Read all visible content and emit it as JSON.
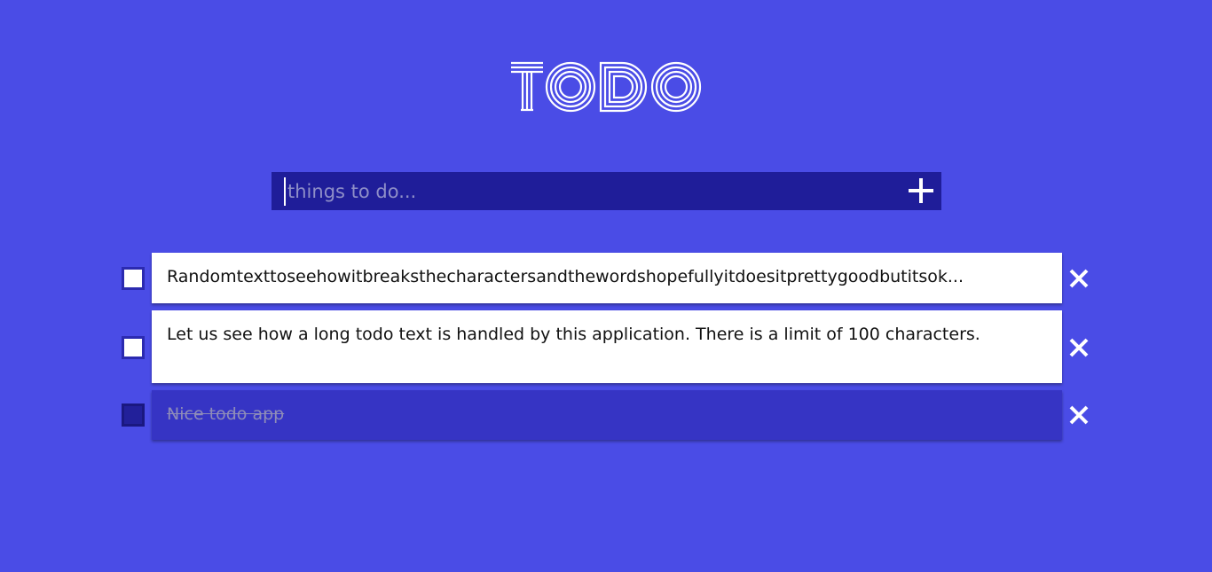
{
  "app": {
    "logo_text": "TODO",
    "accent": "#4a4ce6"
  },
  "add_form": {
    "placeholder": "things to do...",
    "value": "",
    "add_icon": "plus-icon"
  },
  "todos": [
    {
      "text": "Randomtexttoseehowitbreaksthecharactersandthewordshopefullyitdoesitprettygoodbutitsok...",
      "completed": false,
      "delete_icon": "close-icon"
    },
    {
      "text": "Let us see how a long todo text is handled by this application. There is a limit of 100 characters.",
      "completed": false,
      "delete_icon": "close-icon"
    },
    {
      "text": "Nice todo app",
      "completed": true,
      "delete_icon": "close-icon"
    }
  ]
}
